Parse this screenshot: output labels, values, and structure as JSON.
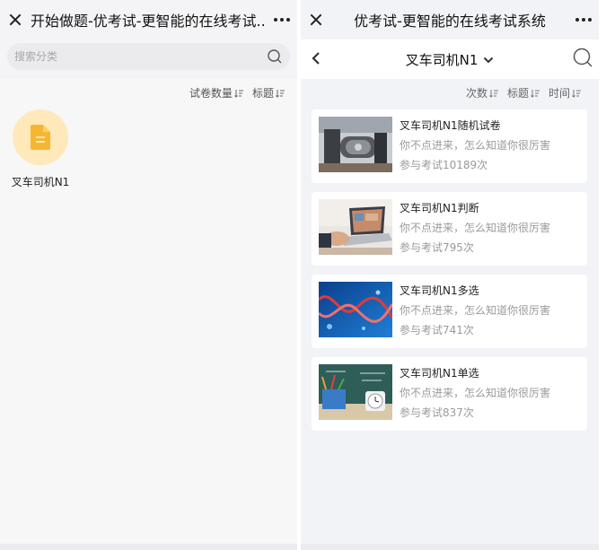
{
  "left_panel": {
    "title": "开始做题-优考试-更智能的在线考试...",
    "search_placeholder": "搜索分类",
    "sort": [
      "试卷数量",
      "标题"
    ],
    "category": {
      "label": "叉车司机N1"
    }
  },
  "right_panel": {
    "title": "优考试-更智能的在线考试系统",
    "nav_title": "叉车司机N1",
    "sort": [
      "次数",
      "标题",
      "时间"
    ],
    "papers": [
      {
        "title": "叉车司机N1随机试卷",
        "desc": "你不点进来，怎么知道你很厉害",
        "count": "参与考试10189次",
        "image": "industrial-machine"
      },
      {
        "title": "叉车司机N1判断",
        "desc": "你不点进来，怎么知道你很厉害",
        "count": "参与考试795次",
        "image": "laptop-hands"
      },
      {
        "title": "叉车司机N1多选",
        "desc": "你不点进来，怎么知道你很厉害",
        "count": "参与考试741次",
        "image": "dna-helix"
      },
      {
        "title": "叉车司机N1单选",
        "desc": "你不点进来，怎么知道你很厉害",
        "count": "参与考试837次",
        "image": "chalkboard-clock"
      }
    ]
  },
  "colors": {
    "category_circle": "#ffe8b9",
    "doc_icon": "#f5b731",
    "background": "#f2f3f7"
  }
}
